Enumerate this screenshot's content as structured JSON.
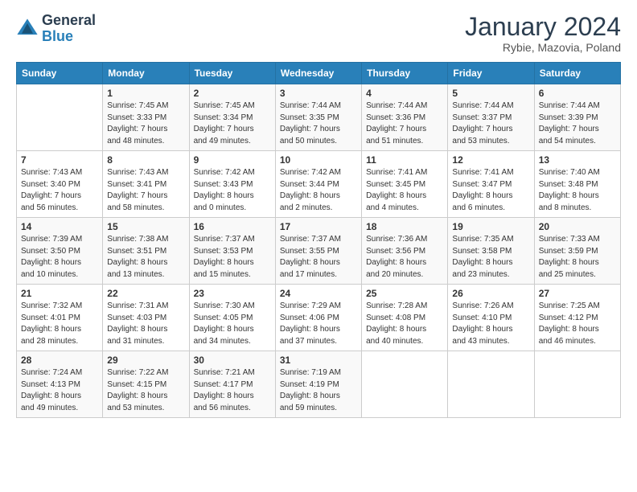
{
  "logo": {
    "line1": "General",
    "line2": "Blue"
  },
  "title": {
    "month_year": "January 2024",
    "location": "Rybie, Mazovia, Poland"
  },
  "days_of_week": [
    "Sunday",
    "Monday",
    "Tuesday",
    "Wednesday",
    "Thursday",
    "Friday",
    "Saturday"
  ],
  "weeks": [
    [
      {
        "num": "",
        "info": ""
      },
      {
        "num": "1",
        "info": "Sunrise: 7:45 AM\nSunset: 3:33 PM\nDaylight: 7 hours\nand 48 minutes."
      },
      {
        "num": "2",
        "info": "Sunrise: 7:45 AM\nSunset: 3:34 PM\nDaylight: 7 hours\nand 49 minutes."
      },
      {
        "num": "3",
        "info": "Sunrise: 7:44 AM\nSunset: 3:35 PM\nDaylight: 7 hours\nand 50 minutes."
      },
      {
        "num": "4",
        "info": "Sunrise: 7:44 AM\nSunset: 3:36 PM\nDaylight: 7 hours\nand 51 minutes."
      },
      {
        "num": "5",
        "info": "Sunrise: 7:44 AM\nSunset: 3:37 PM\nDaylight: 7 hours\nand 53 minutes."
      },
      {
        "num": "6",
        "info": "Sunrise: 7:44 AM\nSunset: 3:39 PM\nDaylight: 7 hours\nand 54 minutes."
      }
    ],
    [
      {
        "num": "7",
        "info": "Sunrise: 7:43 AM\nSunset: 3:40 PM\nDaylight: 7 hours\nand 56 minutes."
      },
      {
        "num": "8",
        "info": "Sunrise: 7:43 AM\nSunset: 3:41 PM\nDaylight: 7 hours\nand 58 minutes."
      },
      {
        "num": "9",
        "info": "Sunrise: 7:42 AM\nSunset: 3:43 PM\nDaylight: 8 hours\nand 0 minutes."
      },
      {
        "num": "10",
        "info": "Sunrise: 7:42 AM\nSunset: 3:44 PM\nDaylight: 8 hours\nand 2 minutes."
      },
      {
        "num": "11",
        "info": "Sunrise: 7:41 AM\nSunset: 3:45 PM\nDaylight: 8 hours\nand 4 minutes."
      },
      {
        "num": "12",
        "info": "Sunrise: 7:41 AM\nSunset: 3:47 PM\nDaylight: 8 hours\nand 6 minutes."
      },
      {
        "num": "13",
        "info": "Sunrise: 7:40 AM\nSunset: 3:48 PM\nDaylight: 8 hours\nand 8 minutes."
      }
    ],
    [
      {
        "num": "14",
        "info": "Sunrise: 7:39 AM\nSunset: 3:50 PM\nDaylight: 8 hours\nand 10 minutes."
      },
      {
        "num": "15",
        "info": "Sunrise: 7:38 AM\nSunset: 3:51 PM\nDaylight: 8 hours\nand 13 minutes."
      },
      {
        "num": "16",
        "info": "Sunrise: 7:37 AM\nSunset: 3:53 PM\nDaylight: 8 hours\nand 15 minutes."
      },
      {
        "num": "17",
        "info": "Sunrise: 7:37 AM\nSunset: 3:55 PM\nDaylight: 8 hours\nand 17 minutes."
      },
      {
        "num": "18",
        "info": "Sunrise: 7:36 AM\nSunset: 3:56 PM\nDaylight: 8 hours\nand 20 minutes."
      },
      {
        "num": "19",
        "info": "Sunrise: 7:35 AM\nSunset: 3:58 PM\nDaylight: 8 hours\nand 23 minutes."
      },
      {
        "num": "20",
        "info": "Sunrise: 7:33 AM\nSunset: 3:59 PM\nDaylight: 8 hours\nand 25 minutes."
      }
    ],
    [
      {
        "num": "21",
        "info": "Sunrise: 7:32 AM\nSunset: 4:01 PM\nDaylight: 8 hours\nand 28 minutes."
      },
      {
        "num": "22",
        "info": "Sunrise: 7:31 AM\nSunset: 4:03 PM\nDaylight: 8 hours\nand 31 minutes."
      },
      {
        "num": "23",
        "info": "Sunrise: 7:30 AM\nSunset: 4:05 PM\nDaylight: 8 hours\nand 34 minutes."
      },
      {
        "num": "24",
        "info": "Sunrise: 7:29 AM\nSunset: 4:06 PM\nDaylight: 8 hours\nand 37 minutes."
      },
      {
        "num": "25",
        "info": "Sunrise: 7:28 AM\nSunset: 4:08 PM\nDaylight: 8 hours\nand 40 minutes."
      },
      {
        "num": "26",
        "info": "Sunrise: 7:26 AM\nSunset: 4:10 PM\nDaylight: 8 hours\nand 43 minutes."
      },
      {
        "num": "27",
        "info": "Sunrise: 7:25 AM\nSunset: 4:12 PM\nDaylight: 8 hours\nand 46 minutes."
      }
    ],
    [
      {
        "num": "28",
        "info": "Sunrise: 7:24 AM\nSunset: 4:13 PM\nDaylight: 8 hours\nand 49 minutes."
      },
      {
        "num": "29",
        "info": "Sunrise: 7:22 AM\nSunset: 4:15 PM\nDaylight: 8 hours\nand 53 minutes."
      },
      {
        "num": "30",
        "info": "Sunrise: 7:21 AM\nSunset: 4:17 PM\nDaylight: 8 hours\nand 56 minutes."
      },
      {
        "num": "31",
        "info": "Sunrise: 7:19 AM\nSunset: 4:19 PM\nDaylight: 8 hours\nand 59 minutes."
      },
      {
        "num": "",
        "info": ""
      },
      {
        "num": "",
        "info": ""
      },
      {
        "num": "",
        "info": ""
      }
    ]
  ]
}
